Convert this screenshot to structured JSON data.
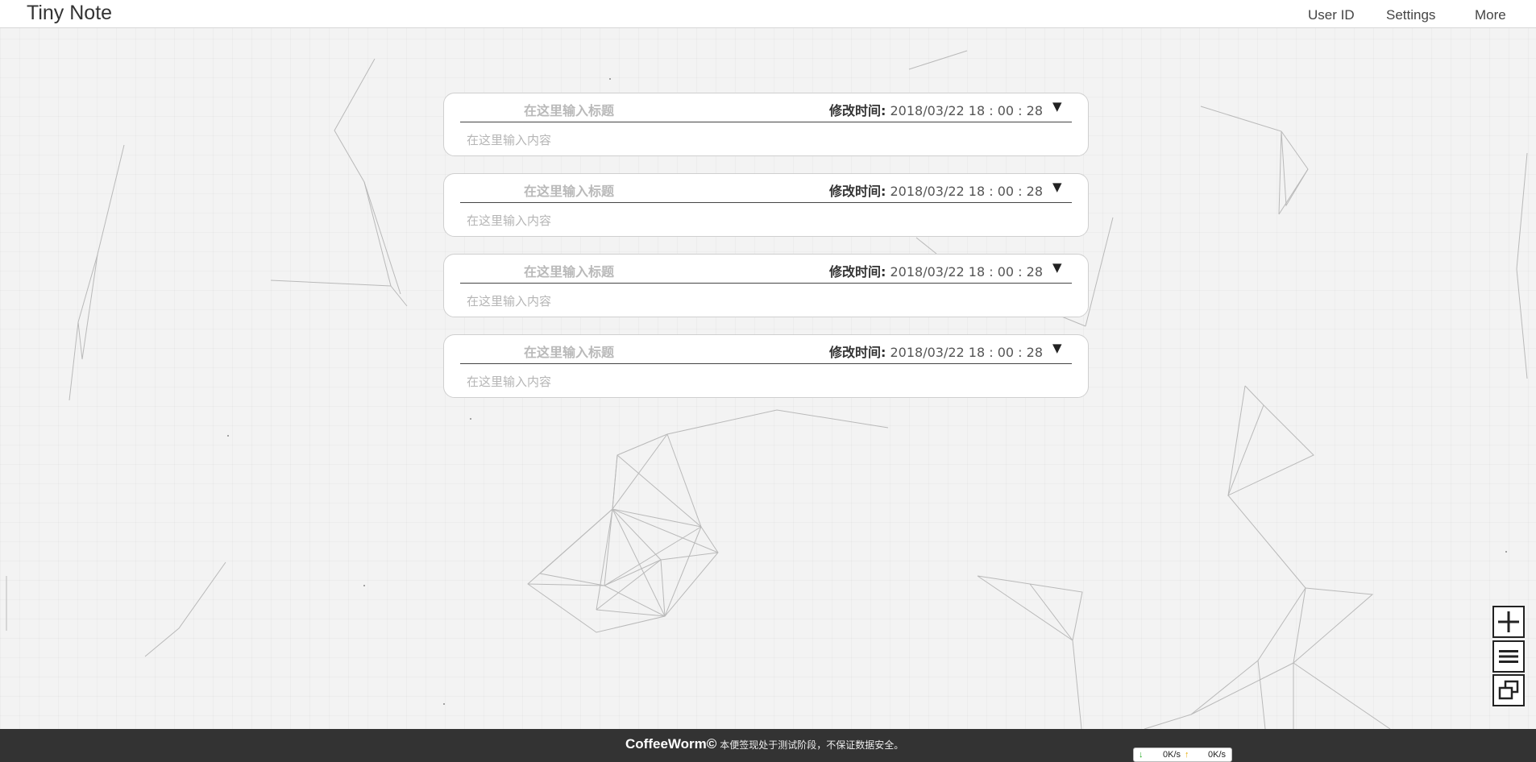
{
  "header": {
    "brand": "Tiny Note",
    "nav": [
      "User ID",
      "Settings",
      "More"
    ]
  },
  "notes": [
    {
      "title_placeholder": "在这里输入标题",
      "time_label": "修改时间:",
      "time_value": "2018/03/22 18 : 00 : 28",
      "arrow": "▼",
      "content_placeholder": "在这里输入内容"
    },
    {
      "title_placeholder": "在这里输入标题",
      "time_label": "修改时间:",
      "time_value": "2018/03/22 18 : 00 : 28",
      "arrow": "▼",
      "content_placeholder": "在这里输入内容"
    },
    {
      "title_placeholder": "在这里输入标题",
      "time_label": "修改时间:",
      "time_value": "2018/03/22 18 : 00 : 28",
      "arrow": "▼",
      "content_placeholder": "在这里输入内容"
    },
    {
      "title_placeholder": "在这里输入标题",
      "time_label": "修改时间:",
      "time_value": "2018/03/22 18 : 00 : 28",
      "arrow": "▼",
      "content_placeholder": "在这里输入内容"
    }
  ],
  "side_buttons": [
    "plus-icon",
    "menu-icon",
    "window-restore-icon"
  ],
  "footer": {
    "brand": "CoffeeWorm©",
    "note": "本便签现处于测试阶段，不保证数据安全。"
  },
  "speed": {
    "down_icon": "arrow-down-icon",
    "down": "0K/s",
    "up_icon": "arrow-up-icon",
    "up": "0K/s"
  },
  "colors": {
    "footer_bg": "#333333",
    "header_bg": "#ffffff",
    "page_bg": "#f3f3f3"
  }
}
